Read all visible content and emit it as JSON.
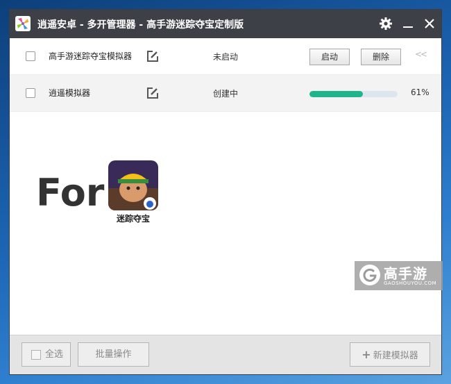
{
  "titlebar": {
    "title": "逍遥安卓 - 多开管理器 - 高手游迷踪夺宝定制版"
  },
  "instances": [
    {
      "name": "高手游迷踪夺宝模拟器",
      "status": "未启动",
      "start_label": "启动",
      "delete_label": "删除",
      "collapse_glyph": "<<"
    },
    {
      "name": "逍遥模拟器",
      "status": "创建中",
      "progress": 0.61,
      "progress_label": "61%",
      "progress_color": "#1fb58b"
    }
  ],
  "promo": {
    "for_text": "For",
    "game_name": "迷踪夺宝"
  },
  "watermark": {
    "title": "高手游",
    "subtitle": "GAOSHOUYOU.COM"
  },
  "footer": {
    "select_all_label": "全选",
    "batch_label": "批量操作",
    "new_label": "新建模拟器",
    "plus_glyph": "+"
  },
  "colors": {
    "titlebar": "#3d4046",
    "accent": "#1fb58b"
  },
  "icons": [
    "app-logo-icon",
    "gear-icon",
    "minimize-icon",
    "close-icon",
    "edit-icon",
    "collapse-icon",
    "plus-icon"
  ]
}
